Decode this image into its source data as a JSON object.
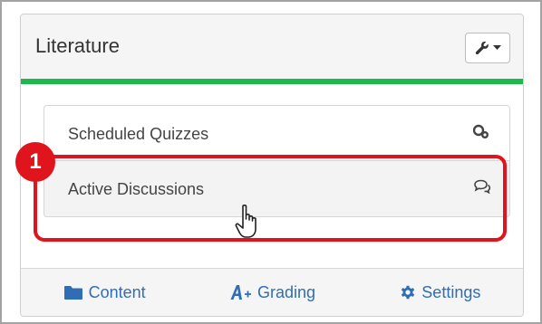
{
  "card": {
    "title": "Literature",
    "tools_icon": "wrench-icon",
    "dropdown_icon": "caret-down-icon"
  },
  "list": {
    "items": [
      {
        "label": "Scheduled Quizzes",
        "icon": "quiz-icon"
      },
      {
        "label": "Active Discussions",
        "icon": "discussion-icon"
      }
    ]
  },
  "annotation": {
    "step_number": "1",
    "color": "#e0141c"
  },
  "footer": {
    "links": [
      {
        "label": "Content",
        "icon": "folder-icon"
      },
      {
        "label": "Grading",
        "icon": "grading-icon"
      },
      {
        "label": "Settings",
        "icon": "gear-icon"
      }
    ]
  },
  "colors": {
    "accent_green": "#1fb84f",
    "link_blue": "#2f6db5",
    "highlight_red": "#e0141c"
  }
}
